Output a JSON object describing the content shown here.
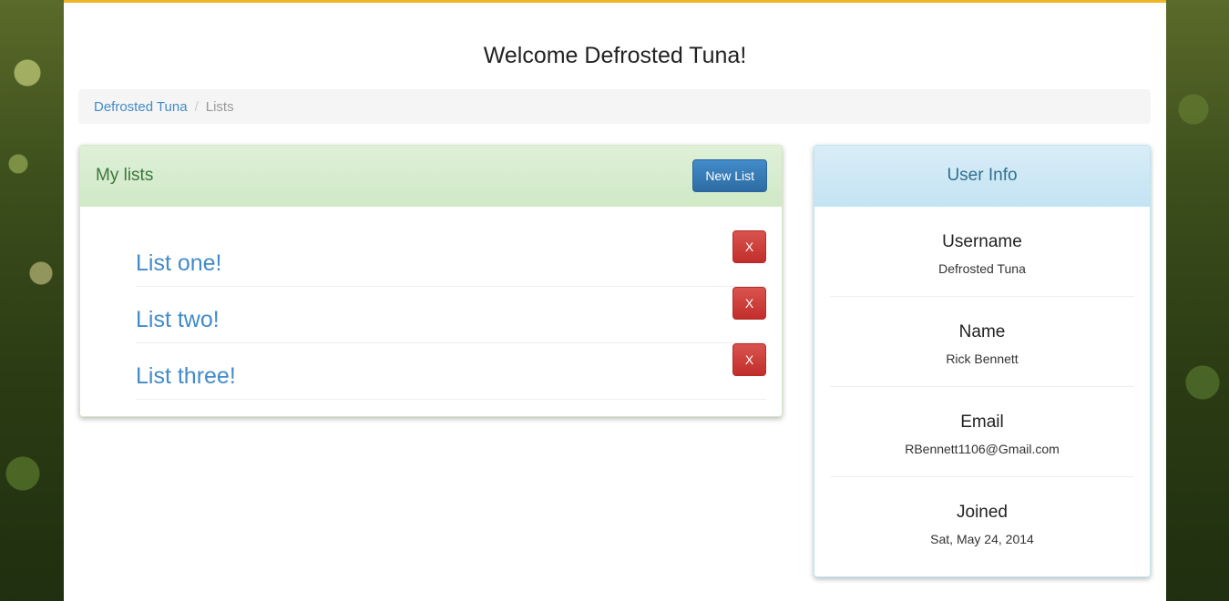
{
  "header": {
    "title": "Welcome Defrosted Tuna!"
  },
  "breadcrumb": {
    "home": "Defrosted Tuna",
    "separator": "/",
    "current": "Lists"
  },
  "lists_panel": {
    "title": "My lists",
    "new_button": "New List",
    "items": [
      {
        "label": "List one!",
        "delete_label": "X"
      },
      {
        "label": "List two!",
        "delete_label": "X"
      },
      {
        "label": "List three!",
        "delete_label": "X"
      }
    ]
  },
  "user_info": {
    "title": "User Info",
    "fields": [
      {
        "label": "Username",
        "value": "Defrosted Tuna"
      },
      {
        "label": "Name",
        "value": "Rick Bennett"
      },
      {
        "label": "Email",
        "value": "RBennett1106@Gmail.com"
      },
      {
        "label": "Joined",
        "value": "Sat, May 24, 2014"
      }
    ]
  },
  "colors": {
    "accent_top": "#f0b429",
    "link": "#428bca",
    "primary": "#428bca",
    "danger": "#d9534f",
    "success_header": "#dff0d8",
    "info_header": "#d9edf7"
  }
}
